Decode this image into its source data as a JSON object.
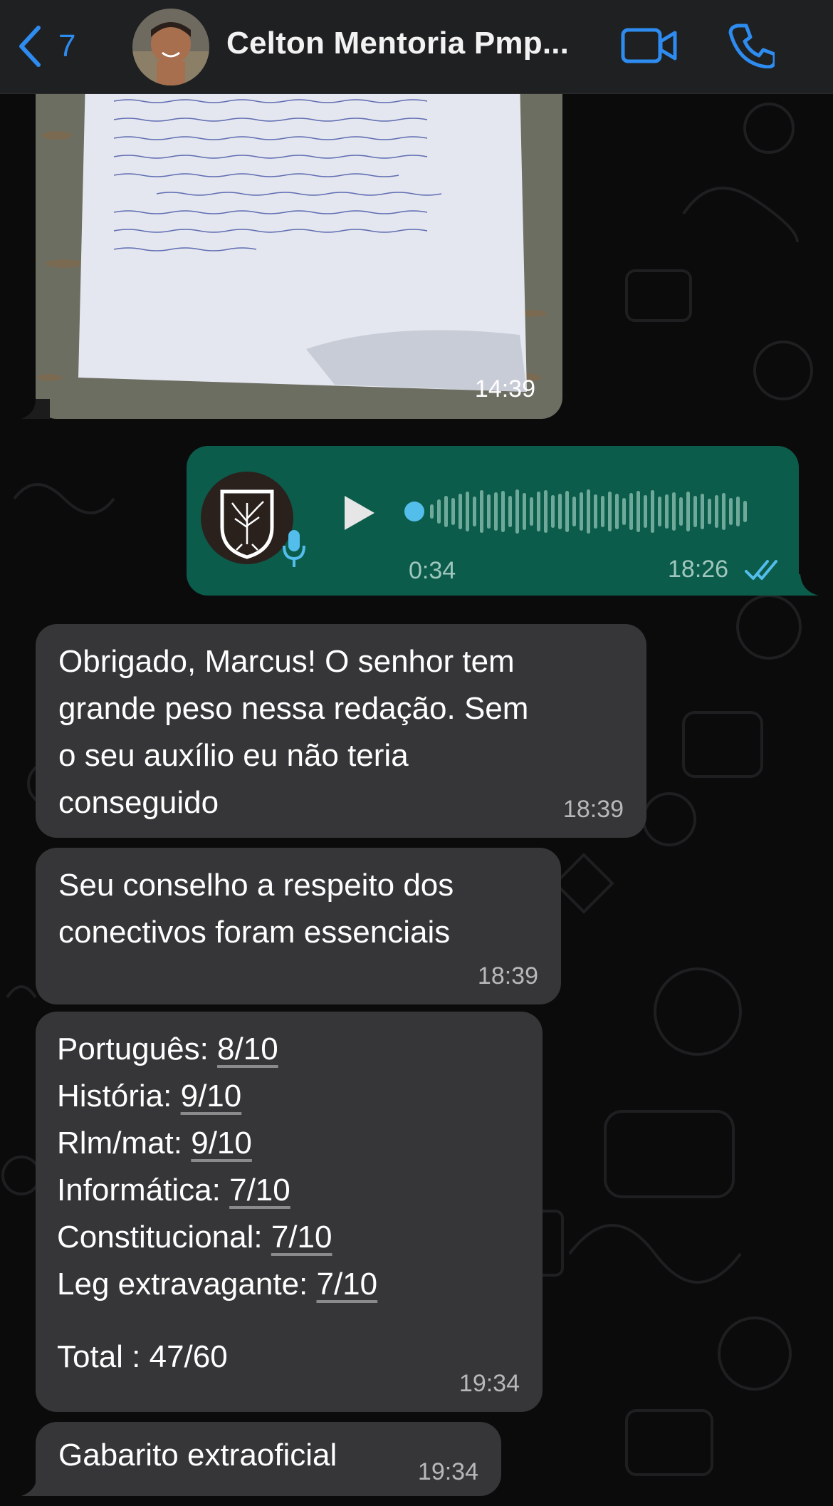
{
  "header": {
    "back_count": "7",
    "title": "Celton Mentoria Pmp...",
    "accent": "#2e8bf0"
  },
  "messages": {
    "photo": {
      "time": "14:39"
    },
    "voice": {
      "duration": "0:34",
      "time": "18:26",
      "status": "read"
    },
    "m1": {
      "text": "Obrigado, Marcus! O senhor tem\ngrande peso nessa redação. Sem\no seu auxílio eu não teria\nconseguido",
      "time": "18:39"
    },
    "m2": {
      "text": "Seu conselho a respeito dos\nconectivos foram essenciais",
      "time": "18:39"
    },
    "m3": {
      "lines": [
        {
          "label": "Português: ",
          "value": "8/10"
        },
        {
          "label": "História: ",
          "value": "9/10"
        },
        {
          "label": "Rlm/mat: ",
          "value": "9/10"
        },
        {
          "label": "Informática: ",
          "value": "7/10"
        },
        {
          "label": "Constitucional: ",
          "value": "7/10"
        },
        {
          "label": "Leg extravagante: ",
          "value": "7/10"
        }
      ],
      "total": "Total : 47/60",
      "time": "19:34"
    },
    "m4": {
      "text": "Gabarito extraoficial",
      "time": "19:34"
    }
  },
  "colors": {
    "incoming_bubble": "#363638",
    "outgoing_bubble": "#0c5c4c",
    "read_ticks": "#53bdeb"
  }
}
